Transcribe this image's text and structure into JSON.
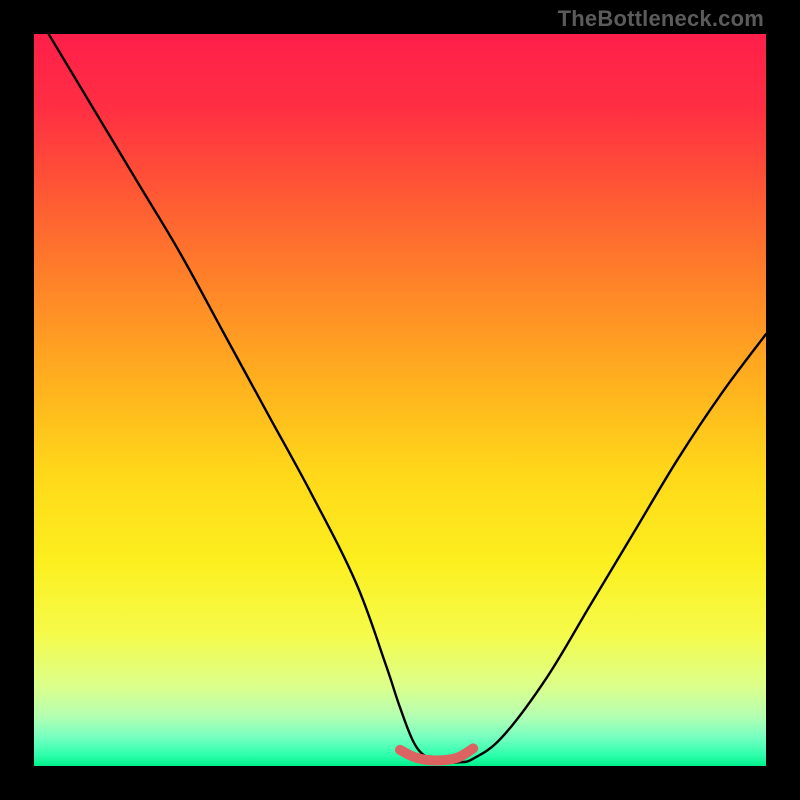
{
  "watermark": "TheBottleneck.com",
  "gradient_stops": [
    {
      "offset": 0.0,
      "color": "#ff1f4a"
    },
    {
      "offset": 0.1,
      "color": "#ff2e43"
    },
    {
      "offset": 0.22,
      "color": "#ff5934"
    },
    {
      "offset": 0.35,
      "color": "#ff8628"
    },
    {
      "offset": 0.48,
      "color": "#ffb21e"
    },
    {
      "offset": 0.6,
      "color": "#ffd81a"
    },
    {
      "offset": 0.72,
      "color": "#fcef1f"
    },
    {
      "offset": 0.82,
      "color": "#f5fb4a"
    },
    {
      "offset": 0.89,
      "color": "#dcff8a"
    },
    {
      "offset": 0.93,
      "color": "#b7ffb0"
    },
    {
      "offset": 0.96,
      "color": "#77ffc0"
    },
    {
      "offset": 0.985,
      "color": "#2effad"
    },
    {
      "offset": 1.0,
      "color": "#00ef8a"
    }
  ],
  "chart_data": {
    "type": "line",
    "title": "",
    "xlabel": "",
    "ylabel": "",
    "xlim": [
      0,
      100
    ],
    "ylim": [
      0,
      100
    ],
    "series": [
      {
        "name": "bottleneck-curve",
        "x": [
          2,
          8,
          14,
          20,
          26,
          32,
          38,
          44,
          48,
          50,
          52,
          54,
          56,
          58,
          60,
          64,
          70,
          76,
          82,
          88,
          94,
          100
        ],
        "y": [
          100,
          90,
          80,
          70,
          59,
          48,
          37,
          25,
          14,
          8,
          3,
          1,
          0.5,
          0.5,
          1,
          4,
          12,
          22,
          32,
          42,
          51,
          59
        ]
      },
      {
        "name": "flat-highlight",
        "x": [
          50,
          52,
          54,
          56,
          58,
          60
        ],
        "y": [
          2.2,
          1.2,
          0.8,
          0.8,
          1.2,
          2.4
        ]
      }
    ],
    "annotations": []
  },
  "colors": {
    "curve": "#000000",
    "highlight": "#dd6363",
    "frame": "#000000"
  }
}
